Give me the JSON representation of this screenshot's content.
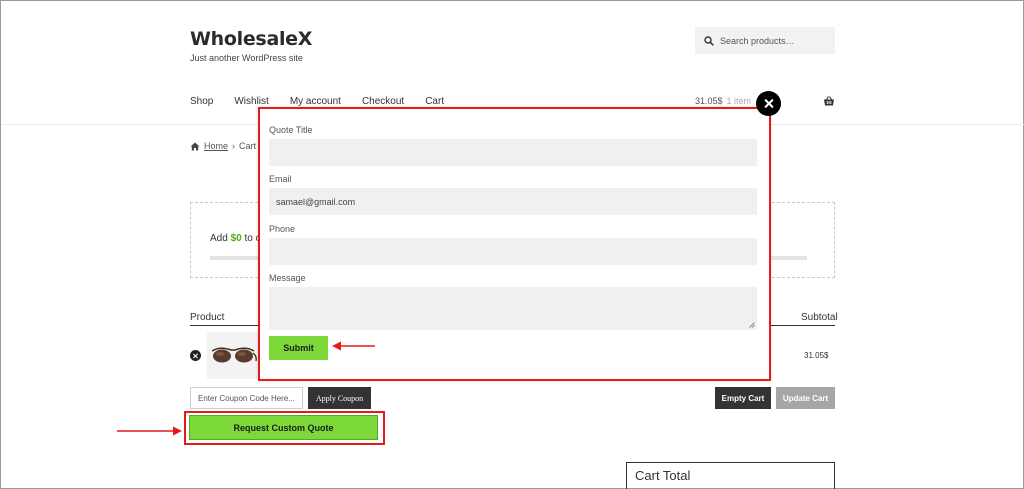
{
  "site": {
    "title": "WholesaleX",
    "tagline": "Just another WordPress site"
  },
  "search": {
    "placeholder": "Search products…",
    "icon": "search-icon"
  },
  "nav": {
    "items": [
      "Shop",
      "Wishlist",
      "My account",
      "Checkout",
      "Cart"
    ]
  },
  "header_cart": {
    "amount": "31.05$",
    "items": "1 item",
    "icon": "basket-icon"
  },
  "breadcrumb": {
    "home": "Home",
    "separator": "›",
    "current": "Cart"
  },
  "notice": {
    "prefix": "Add ",
    "amount": "$0",
    "suffix": " to c"
  },
  "cart_table": {
    "headers": {
      "product": "Product",
      "subtotal": "Subtotal"
    },
    "rows": [
      {
        "product_image": "sunglasses",
        "subtotal": "31.05$"
      }
    ]
  },
  "coupon": {
    "placeholder": "Enter Coupon Code Here...",
    "apply_label": "Apply Coupon"
  },
  "actions": {
    "empty_cart": "Empty Cart",
    "update_cart": "Update Cart",
    "request_quote": "Request Custom Quote"
  },
  "cart_total": {
    "title": "Cart Total"
  },
  "quote_modal": {
    "fields": {
      "title_label": "Quote Title",
      "title_value": "",
      "email_label": "Email",
      "email_value": "samael@gmail.com",
      "phone_label": "Phone",
      "phone_value": "",
      "message_label": "Message",
      "message_value": ""
    },
    "submit_label": "Submit",
    "close_icon": "close-icon"
  },
  "colors": {
    "accent_green": "#7dd83a",
    "highlight_red": "#e41b1b",
    "dark_button": "#333333",
    "disabled_button": "#a6a6a6",
    "notice_amount": "#4caf1e"
  }
}
